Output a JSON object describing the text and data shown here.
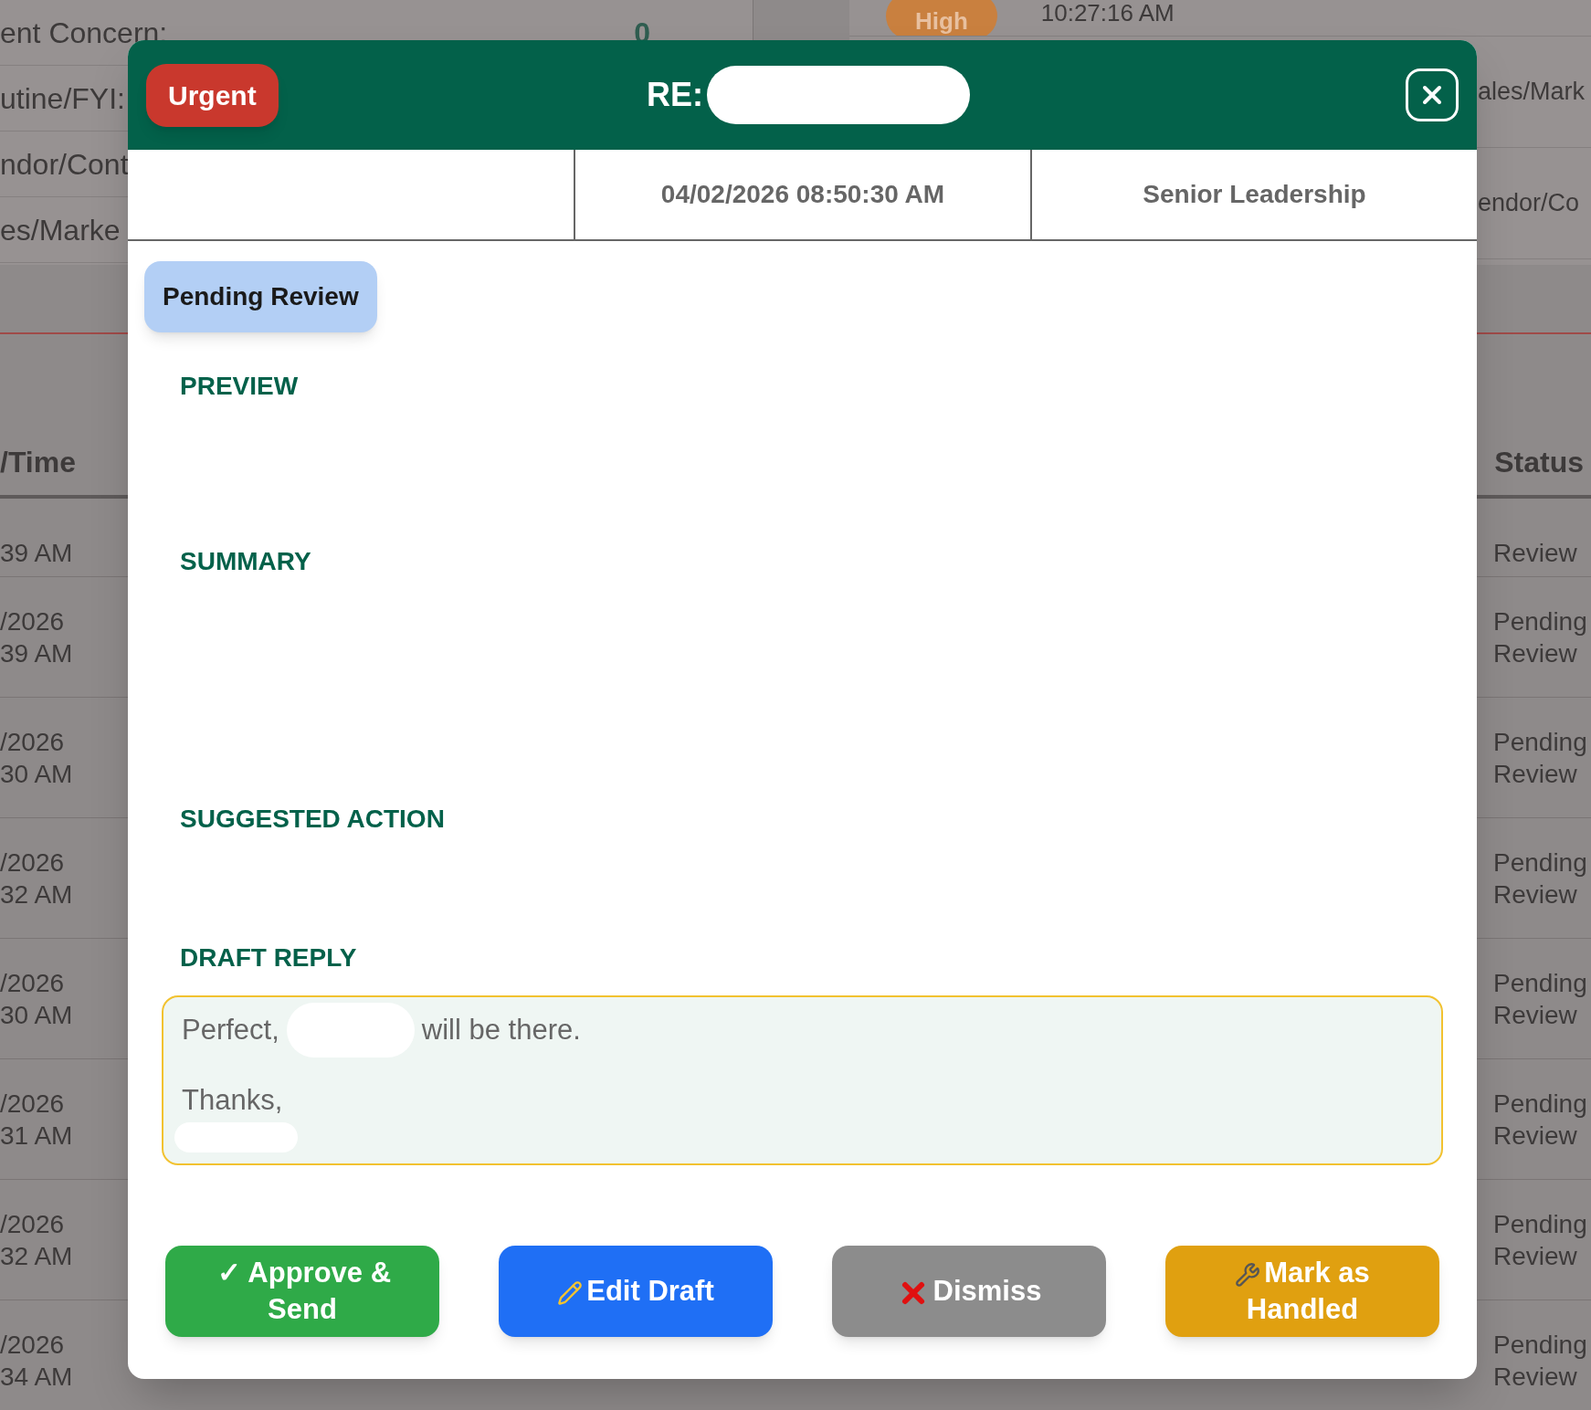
{
  "background": {
    "summary_rows": [
      {
        "label": "ent Concern:",
        "count": "0"
      },
      {
        "label": "utine/FYI:"
      },
      {
        "label": "ndor/Cont"
      },
      {
        "label": "es/Marke"
      }
    ],
    "recent": {
      "priority": "High",
      "time": "10:27:16 AM",
      "categories": [
        "ales/Mark",
        "endor/Co"
      ]
    },
    "table": {
      "columns": [
        "/Time",
        "Status"
      ],
      "rows": [
        {
          "column_1": "39 AM",
          "status": "Review"
        },
        {
          "column_1": "/2026\n39 AM",
          "status": "Pending\nReview"
        },
        {
          "column_1": "/2026\n30 AM",
          "status": "Pending\nReview"
        },
        {
          "column_1": "/2026\n32 AM",
          "status": "Pending\nReview"
        },
        {
          "column_1": "/2026\n30 AM",
          "status": "Pending\nReview"
        },
        {
          "column_1": "/2026\n31 AM",
          "status": "Pending\nReview"
        },
        {
          "column_1": "/2026\n32 AM",
          "status": "Pending\nReview"
        },
        {
          "column_1": "/2026\n34 AM",
          "status": "Pending\nReview"
        }
      ]
    }
  },
  "dialog": {
    "priority": {
      "label": "Urgent",
      "kind": "urgent"
    },
    "subject_prefix": "RE:",
    "info": [
      "04/02/2026 08:50:30 AM",
      "Senior Leadership"
    ],
    "status": "Pending Review",
    "sections": [
      "PREVIEW",
      "SUMMARY",
      "SUGGESTED ACTION",
      "DRAFT REPLY"
    ],
    "draft_reply": {
      "line_1_start": "Perfect,",
      "line_1_end": "will be there.",
      "line_2": "Thanks,"
    },
    "buttons": [
      {
        "label": "✓ Approve & Send",
        "kind": "approve"
      },
      {
        "label": "Edit Draft",
        "kind": "edit"
      },
      {
        "label": "Dismiss",
        "kind": "dismiss"
      },
      {
        "label": "Mark as Handled",
        "kind": "handled"
      }
    ]
  }
}
